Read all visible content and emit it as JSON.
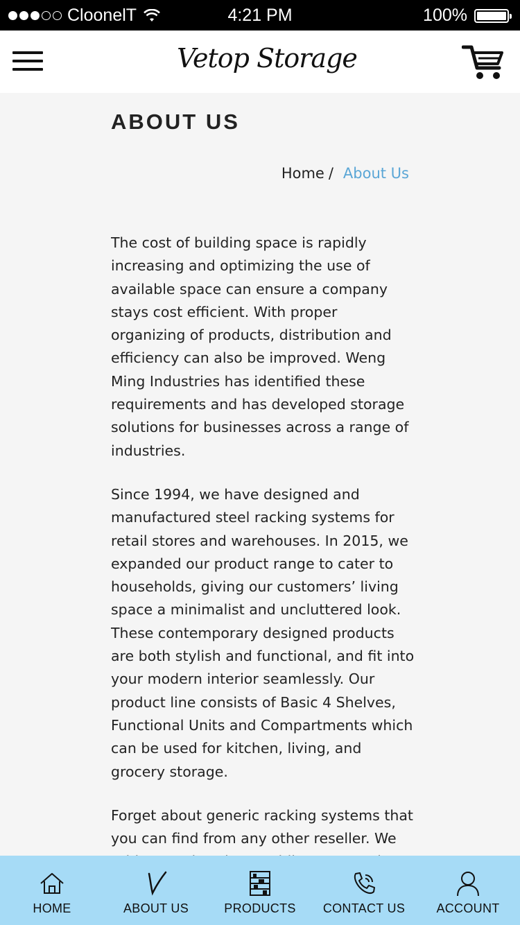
{
  "status_bar": {
    "carrier": "CloonelT",
    "time": "4:21 PM",
    "battery": "100%",
    "signal_bars_filled": 3,
    "signal_bars_total": 5
  },
  "header": {
    "logo": "Vetop Storage",
    "menu_icon": "hamburger-menu-icon",
    "cart_icon": "shopping-cart-icon"
  },
  "page": {
    "title": "ABOUT US",
    "breadcrumb": {
      "home": "Home",
      "separator": "/",
      "current": "About Us"
    },
    "paragraphs": [
      "The cost of building space is rapidly increasing and optimizing the use of available space can ensure a company stays cost efficient. With proper organizing of products, distribution and efficiency can also be improved. Weng Ming Industries has identified these requirements and has developed storage solutions for businesses across a range of industries.",
      "Since 1994, we have designed and manufactured steel racking systems for retail stores and warehouses. In 2015, we expanded our product range to cater to households, giving our customers’ living space a minimalist and uncluttered look. These contemporary designed products are both stylish and functional, and fit into your modern interior seamlessly. Our product line consists of Basic 4 Shelves, Functional Units and Compartments which can be used for kitchen, living, and grocery storage.",
      "Forget about generic racking systems that you can find from any other reseller. We pride ourselves by providing top-notch customized designs made from high-grade"
    ]
  },
  "tab_bar": {
    "items": [
      {
        "label": "HOME",
        "icon": "home-icon"
      },
      {
        "label": "ABOUT US",
        "icon": "v-logo-icon"
      },
      {
        "label": "PRODUCTS",
        "icon": "shelf-icon"
      },
      {
        "label": "CONTACT US",
        "icon": "phone-icon"
      },
      {
        "label": "ACCOUNT",
        "icon": "user-icon"
      }
    ]
  },
  "colors": {
    "accent_link": "#5aa6d6",
    "tab_bar_bg": "#a6dbf6",
    "page_bg": "#f5f5f5"
  }
}
